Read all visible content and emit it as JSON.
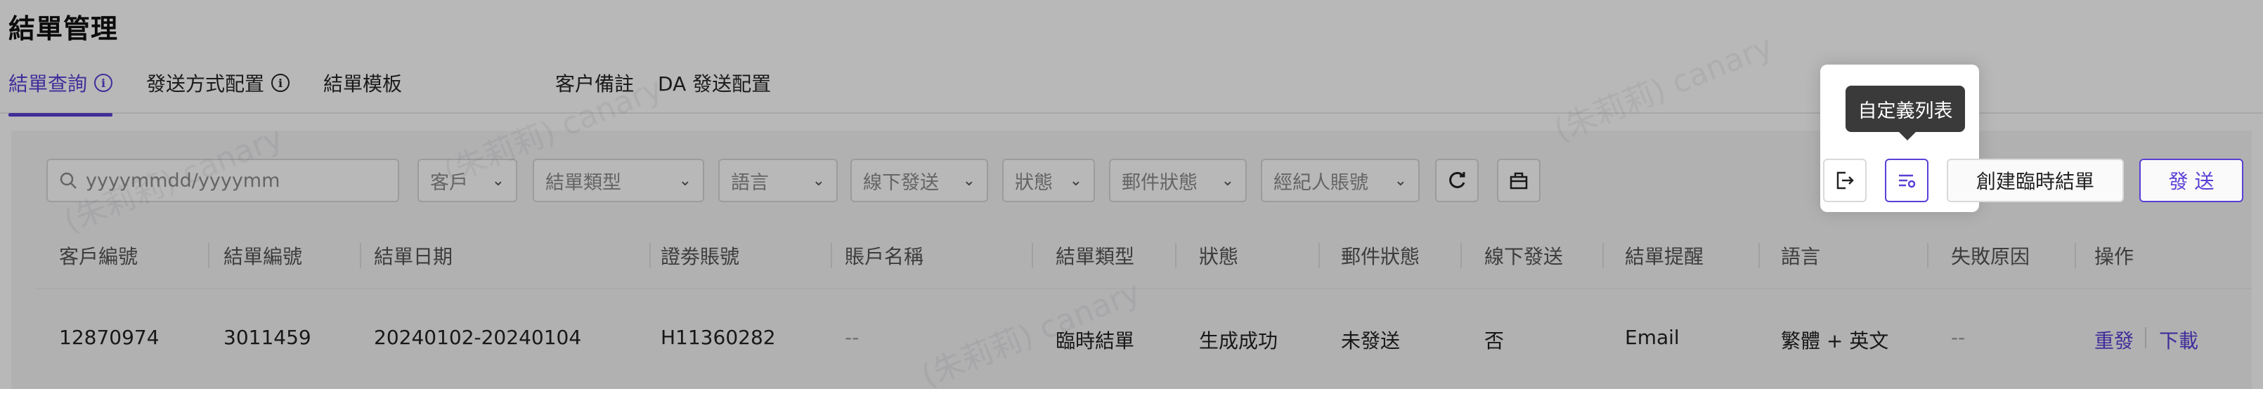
{
  "page": {
    "title": "結單管理"
  },
  "tabs": [
    {
      "label": "結單查詢"
    },
    {
      "label": "發送方式配置"
    },
    {
      "label": "結單模板"
    },
    {
      "label": "客户備註"
    },
    {
      "label": "DA 發送配置"
    }
  ],
  "filters": {
    "date_placeholder": "yyyymmdd/yyyymm",
    "customer": "客戶",
    "statement_type": "結單類型",
    "language": "語言",
    "offline_send": "線下發送",
    "status": "狀態",
    "mail_status": "郵件狀態",
    "broker_account": "經紀人賬號"
  },
  "actions": {
    "tooltip": "自定義列表",
    "create_temp": "創建臨時結單",
    "send": "發 送"
  },
  "table": {
    "headers": [
      "客戶編號",
      "結單編號",
      "結單日期",
      "證劵賬號",
      "賬戶名稱",
      "結單類型",
      "狀態",
      "郵件狀態",
      "線下發送",
      "結單提醒",
      "語言",
      "失敗原因",
      "操作"
    ],
    "rows": [
      {
        "customer_no": "12870974",
        "statement_no": "3011459",
        "statement_date": "20240102-20240104",
        "securities_account": "H11360282",
        "account_name": "--",
        "statement_type": "臨時結單",
        "status": "生成成功",
        "mail_status": "未發送",
        "offline_send": "否",
        "reminder": "Email",
        "language": "繁體 + 英文",
        "fail_reason": "--",
        "action_resend": "重發",
        "action_download": "下載"
      }
    ]
  },
  "watermark": "(朱莉莉) canary",
  "colors": {
    "accent": "#5b3fd6",
    "tooltip_bg": "#3a3a3a"
  },
  "icons": [
    "info-icon",
    "search-icon",
    "chevron-down-icon",
    "refresh-icon",
    "clear-icon",
    "export-icon",
    "column-settings-icon"
  ]
}
